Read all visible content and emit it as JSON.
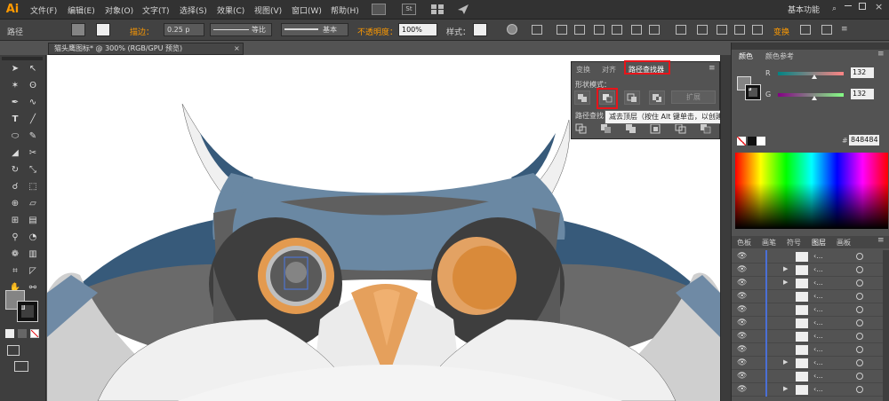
{
  "app": {
    "logo": "Ai"
  },
  "menu": [
    "文件(F)",
    "编辑(E)",
    "对象(O)",
    "文字(T)",
    "选择(S)",
    "效果(C)",
    "视图(V)",
    "窗口(W)",
    "帮助(H)"
  ],
  "workspace": {
    "label": "基本功能"
  },
  "control_bar": {
    "selection_label": "路径",
    "stroke_label": "描边：",
    "stroke_weight": "0.25 p",
    "profile_uniform": "等比",
    "brush_basic": "基本",
    "opacity_label": "不透明度：",
    "opacity_value": "100%",
    "style_label": "样式：",
    "transform_label": "变换"
  },
  "document": {
    "tab_title": "猫头鹰图标* @ 300% (RGB/GPU 预览)"
  },
  "pathfinder_panel": {
    "tabs": [
      "变换",
      "对齐",
      "路径查找器"
    ],
    "shape_modes_label": "形状模式：",
    "expand_button": "扩展",
    "pathfinders_label": "路径查找",
    "tooltip": "减去顶层（按住 Alt 键单击，以创建一个复合形状，并从形状区域中减去）"
  },
  "color_panel": {
    "tabs": [
      "颜色",
      "颜色参考"
    ],
    "channels": [
      {
        "name": "R",
        "value": "132"
      },
      {
        "name": "G",
        "value": "132"
      }
    ],
    "hex_value": "848484",
    "colors": {
      "fill": "#848484",
      "accent": "#ff9a00",
      "highlight": "#e8141a"
    }
  },
  "layers_panel": {
    "tabs": [
      "色板",
      "画笔",
      "符号",
      "图层",
      "画板"
    ],
    "rows": [
      {
        "label": "‹..."
      },
      {
        "label": "‹..."
      },
      {
        "label": "‹..."
      },
      {
        "label": "‹..."
      },
      {
        "label": "‹..."
      },
      {
        "label": "‹..."
      },
      {
        "label": "‹..."
      },
      {
        "label": "‹..."
      },
      {
        "label": "‹..."
      },
      {
        "label": "‹..."
      },
      {
        "label": "‹..."
      }
    ]
  }
}
